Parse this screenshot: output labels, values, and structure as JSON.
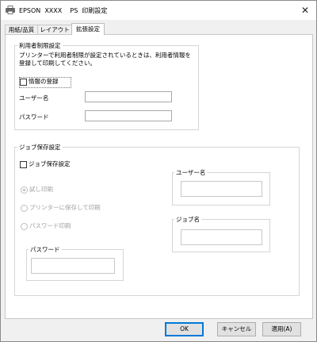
{
  "window": {
    "title": "EPSON  XXXX    PS  印刷設定",
    "close_glyph": "✕"
  },
  "tabs": [
    {
      "label": "用紙/品質"
    },
    {
      "label": "レイアウト"
    },
    {
      "label": "拡張設定",
      "active": true
    }
  ],
  "user_restriction": {
    "title": "利用者制限設定",
    "description": "プリンターで利用者制限が設定されているときは、利用者情報を登録して印刷してください。",
    "register_checkbox": {
      "label": "情報の登録",
      "checked": false
    },
    "username_label": "ユーザー名",
    "username_value": "",
    "password_label": "パスワード",
    "password_value": ""
  },
  "job_storage": {
    "title": "ジョブ保存設定",
    "enable_checkbox": {
      "label": "ジョブ保存設定",
      "checked": false
    },
    "options": [
      {
        "label": "試し印刷",
        "selected": true
      },
      {
        "label": "プリンターに保存して印刷",
        "selected": false
      },
      {
        "label": "パスワード印刷",
        "selected": false
      }
    ],
    "password_group": {
      "title": "パスワード",
      "value": ""
    },
    "username_group": {
      "title": "ユーザー名",
      "value": ""
    },
    "jobname_group": {
      "title": "ジョブ名",
      "value": ""
    }
  },
  "buttons": {
    "ok": "OK",
    "cancel": "キャンセル",
    "apply": "適用(A)"
  }
}
